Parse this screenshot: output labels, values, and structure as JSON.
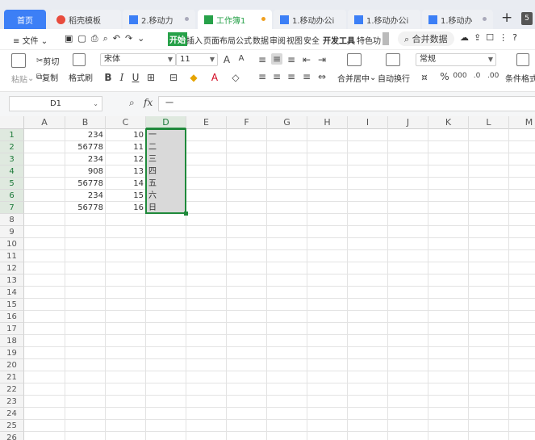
{
  "tabs": [
    {
      "label": "首页"
    },
    {
      "label": "稻壳模板"
    },
    {
      "label": "2.移动力"
    },
    {
      "label": "工作簿1"
    },
    {
      "label": "1.移动办公i"
    },
    {
      "label": "1.移动办公i"
    },
    {
      "label": "1.移动办"
    }
  ],
  "tab_actions": {
    "add": "+",
    "count": "5"
  },
  "menu": {
    "file": "文件",
    "items": [
      "开始",
      "插入",
      "页面布局",
      "公式",
      "数据",
      "审阅",
      "视图",
      "安全",
      "开发工具",
      "特色功"
    ],
    "active_item": "开始",
    "merge_data": "合并数据"
  },
  "ribbon": {
    "paste": "粘贴",
    "cut": "剪切",
    "copy": "复制",
    "format_painter": "格式刷",
    "font_name": "宋体",
    "font_size": "11",
    "merge_center": "合并居中",
    "wrap_text": "自动换行",
    "number_format": "常规",
    "percent": "%",
    "thousands": "000",
    "cond_format": "条件格式"
  },
  "formula_bar": {
    "cell_ref": "D1",
    "fx": "fx",
    "value": "一"
  },
  "columns": [
    "A",
    "B",
    "C",
    "D",
    "E",
    "F",
    "G",
    "H",
    "I",
    "J",
    "K",
    "L",
    "M"
  ],
  "selected_column": "D",
  "rows": [
    "1",
    "2",
    "3",
    "4",
    "5",
    "6",
    "7",
    "8",
    "9",
    "10",
    "11",
    "12",
    "13",
    "14",
    "15",
    "16",
    "17",
    "18",
    "19",
    "20",
    "21",
    "22",
    "23",
    "24",
    "25",
    "26"
  ],
  "data": {
    "B": [
      "234",
      "56778",
      "234",
      "908",
      "56778",
      "234",
      "56778"
    ],
    "C": [
      "10",
      "11",
      "12",
      "13",
      "14",
      "15",
      "16"
    ],
    "D": [
      "一",
      "二",
      "三",
      "四",
      "五",
      "六",
      "日"
    ]
  },
  "colors": {
    "accent": "#1f8a3b",
    "tab_blue": "#3c7ff6",
    "sheet_tab": "#27a149",
    "selection_fill": "#d9d9d9"
  }
}
